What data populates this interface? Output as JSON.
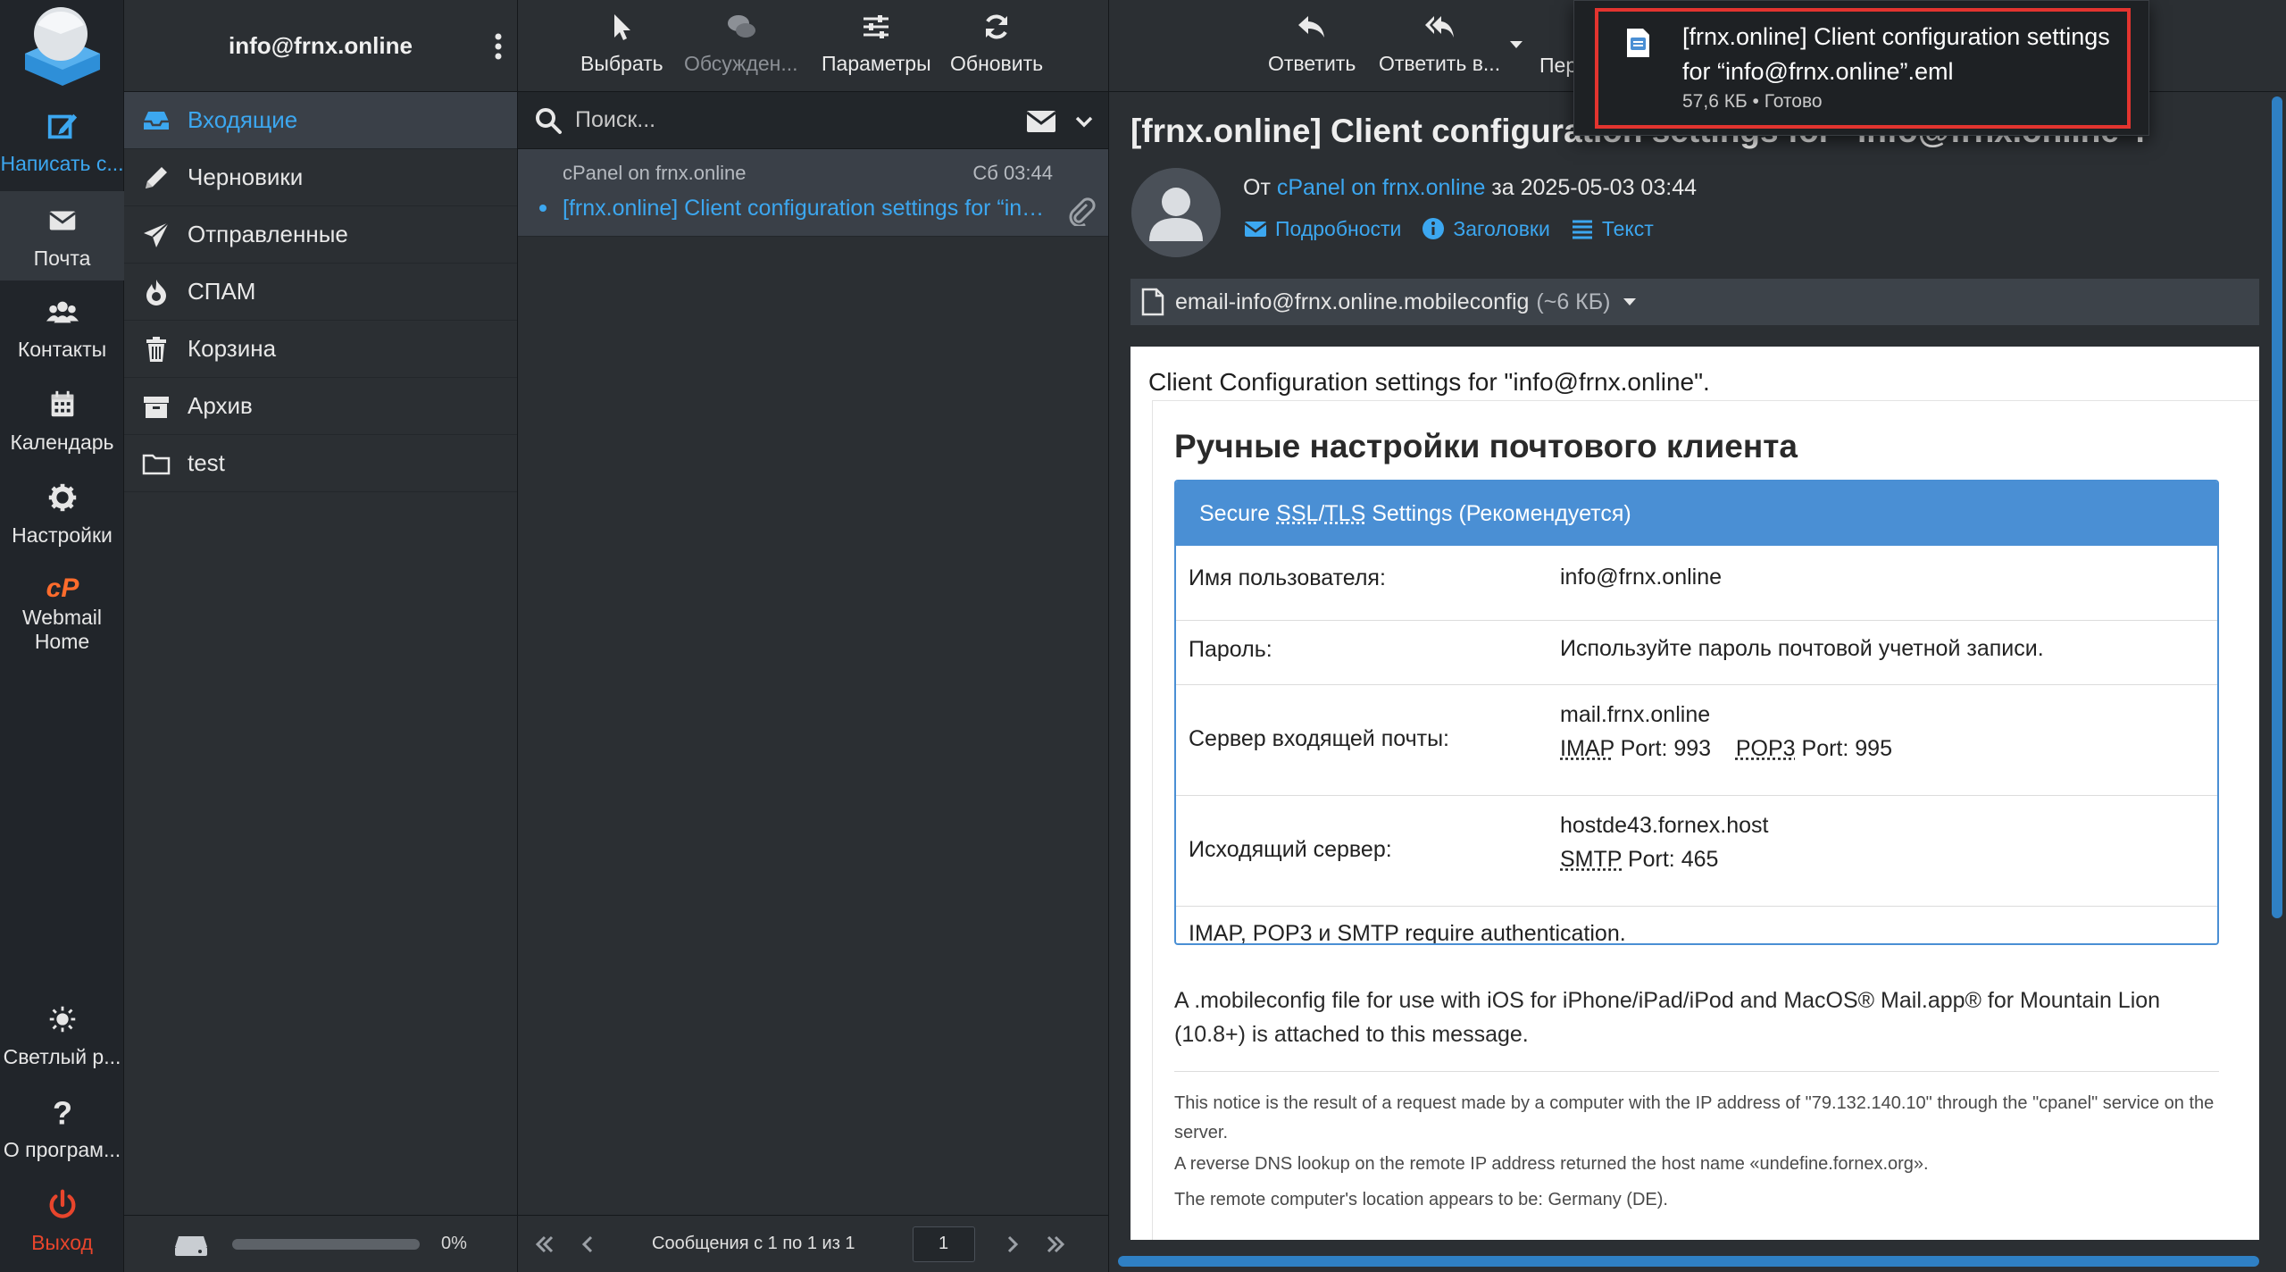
{
  "app_nav": {
    "compose": "Написать с...",
    "mail": "Почта",
    "contacts": "Контакты",
    "calendar": "Календарь",
    "settings": "Настройки",
    "webmail_home_1": "Webmail",
    "webmail_home_2": "Home",
    "light_mode": "Светлый р...",
    "about": "О програм...",
    "logout": "Выход"
  },
  "account": "info@frnx.online",
  "folders": [
    {
      "label": "Входящие",
      "icon": "inbox-icon"
    },
    {
      "label": "Черновики",
      "icon": "pencil-icon"
    },
    {
      "label": "Отправленные",
      "icon": "paper-plane-icon"
    },
    {
      "label": "СПАМ",
      "icon": "fire-icon"
    },
    {
      "label": "Корзина",
      "icon": "trash-icon"
    },
    {
      "label": "Архив",
      "icon": "archive-icon"
    },
    {
      "label": "test",
      "icon": "folder-icon"
    }
  ],
  "quota": {
    "text": "0%",
    "value": 0
  },
  "list_toolbar": {
    "select": "Выбрать",
    "threads": "Обсужден...",
    "options": "Параметры",
    "refresh": "Обновить"
  },
  "search": {
    "placeholder": "Поиск..."
  },
  "message": {
    "from": "cPanel on frnx.online",
    "date": "Сб 03:44",
    "subject": "[frnx.online] Client configuration settings for “info@frnx.online”."
  },
  "pagination": {
    "text": "Сообщения с 1 по 1 из 1",
    "page": "1"
  },
  "view_toolbar": {
    "reply": "Ответить",
    "reply_all": "Ответить в...",
    "forward": "Пер"
  },
  "view": {
    "title": "[frnx.online] Client configuration settings for “info@frnx.online”.",
    "from_prefix": "От",
    "from_link": "cPanel on frnx.online",
    "from_suffix": "за 2025-05-03 03:44",
    "details": "Подробности",
    "headers": "Заголовки",
    "plain": "Текст",
    "attachment_name": "email-info@frnx.online.mobileconfig",
    "attachment_size": "(~6 КБ)"
  },
  "email_body": {
    "intro": "Client Configuration settings for \"info@frnx.online\".",
    "heading": "Ручные настройки почтового клиента",
    "panel_prefix": "Secure",
    "panel_ssl": "SSL",
    "panel_tls": "TLS",
    "panel_suffix": "Settings (Рекомендуется)",
    "username_label": "Имя пользователя:",
    "username_value": "info@frnx.online",
    "password_label": "Пароль:",
    "password_value": "Используйте пароль почтовой учетной записи.",
    "incoming_label": "Сервер входящей почты:",
    "incoming_host": "mail.frnx.online",
    "imap": "IMAP",
    "imap_port": "Port: 993",
    "pop3": "POP3",
    "pop3_port": "Port: 995",
    "outgoing_label": "Исходящий сервер:",
    "outgoing_host": "hostde43.fornex.host",
    "smtp": "SMTP",
    "smtp_port": "Port: 465",
    "auth_note": "IMAP, POP3 и SMTP require authentication.",
    "mobile_note": "A .mobileconfig file for use with iOS for iPhone/iPad/iPod and MacOS® Mail.app® for Mountain Lion (10.8+) is attached to this message.",
    "notice_1": "This notice is the result of a request made by a computer with the IP address of \"79.132.140.10\" through the \"cpanel\" service on the server.",
    "notice_2": "A reverse DNS lookup on the remote IP address returned the host name «undefine.fornex.org».",
    "notice_3": "The remote computer's location appears to be: Germany (DE)."
  },
  "download": {
    "name": "[frnx.online] Client configuration settings for “info@frnx.online”.eml",
    "meta": "57,6 КБ • Готово"
  },
  "colors": {
    "accent": "#3ca7f0",
    "panel": "#4a8fd4",
    "logout": "#e8452c",
    "highlight": "#e3342f"
  }
}
